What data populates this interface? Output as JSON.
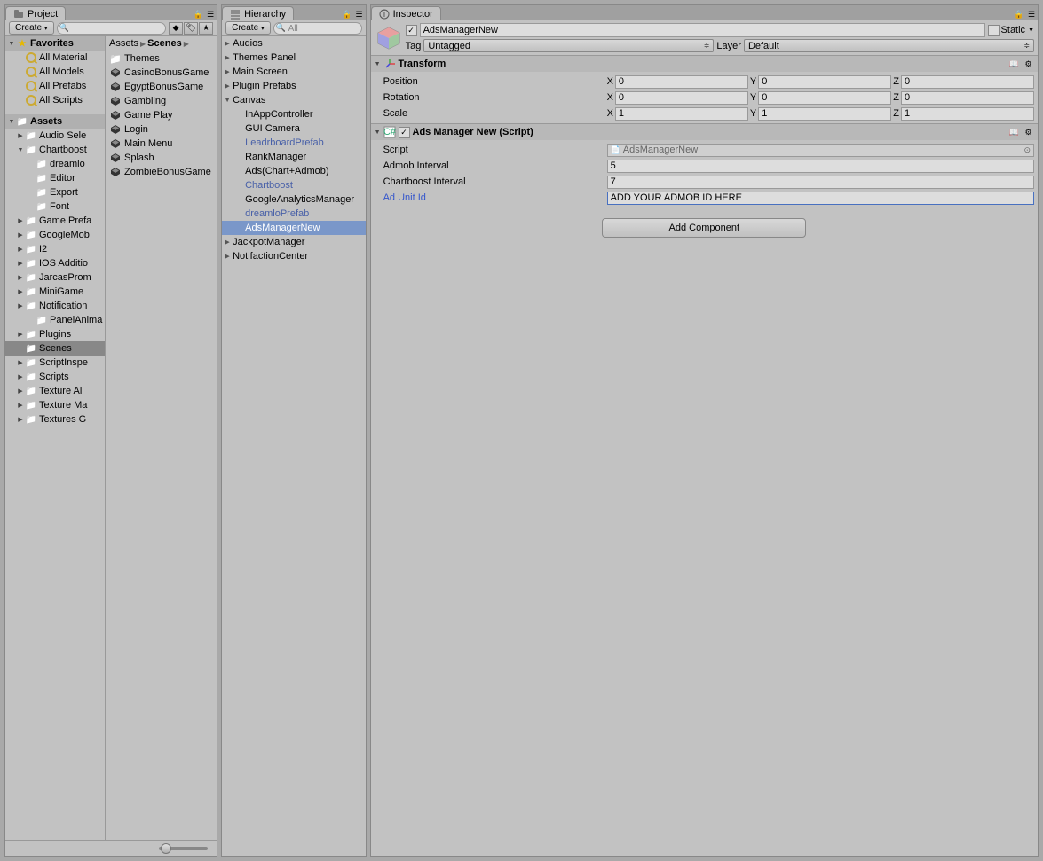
{
  "project": {
    "tab_label": "Project",
    "create_label": "Create",
    "search_placeholder": "",
    "favorites_label": "Favorites",
    "favorites": [
      "All Material",
      "All Models",
      "All Prefabs",
      "All Scripts"
    ],
    "assets_label": "Assets",
    "asset_folders": [
      {
        "name": "Audio Sele",
        "arrow": "closed"
      },
      {
        "name": "Chartboost",
        "arrow": "open"
      },
      {
        "name": "dreamlo",
        "arrow": "none",
        "indent": 2
      },
      {
        "name": "Editor",
        "arrow": "none",
        "indent": 2
      },
      {
        "name": "Export",
        "arrow": "none",
        "indent": 2
      },
      {
        "name": "Font",
        "arrow": "none",
        "indent": 2
      },
      {
        "name": "Game Prefa",
        "arrow": "closed"
      },
      {
        "name": "GoogleMob",
        "arrow": "closed"
      },
      {
        "name": "I2",
        "arrow": "closed"
      },
      {
        "name": "IOS Additio",
        "arrow": "closed"
      },
      {
        "name": "JarcasProm",
        "arrow": "closed"
      },
      {
        "name": "MiniGame",
        "arrow": "closed"
      },
      {
        "name": "Notification",
        "arrow": "closed"
      },
      {
        "name": "PanelAnima",
        "arrow": "none",
        "indent": 2
      },
      {
        "name": "Plugins",
        "arrow": "closed"
      },
      {
        "name": "Scenes",
        "arrow": "none",
        "selected": true
      },
      {
        "name": "ScriptInspe",
        "arrow": "closed"
      },
      {
        "name": "Scripts",
        "arrow": "closed"
      },
      {
        "name": "Texture All",
        "arrow": "closed"
      },
      {
        "name": "Texture Ma",
        "arrow": "closed"
      },
      {
        "name": "Textures G",
        "arrow": "closed"
      }
    ],
    "breadcrumb": [
      "Assets",
      "Scenes"
    ],
    "content": [
      {
        "name": "Themes",
        "type": "folder"
      },
      {
        "name": "CasinoBonusGame",
        "type": "unity"
      },
      {
        "name": "EgyptBonusGame",
        "type": "unity"
      },
      {
        "name": "Gambling",
        "type": "unity"
      },
      {
        "name": "Game Play",
        "type": "unity"
      },
      {
        "name": "Login",
        "type": "unity"
      },
      {
        "name": "Main Menu",
        "type": "unity"
      },
      {
        "name": "Splash",
        "type": "unity"
      },
      {
        "name": "ZombieBonusGame",
        "type": "unity"
      }
    ]
  },
  "hierarchy": {
    "tab_label": "Hierarchy",
    "create_label": "Create",
    "search_placeholder": "All",
    "items": [
      {
        "name": "Audios",
        "arrow": "closed",
        "indent": 0
      },
      {
        "name": "Themes Panel",
        "arrow": "closed",
        "indent": 0
      },
      {
        "name": "Main Screen",
        "arrow": "closed",
        "indent": 0
      },
      {
        "name": "Plugin Prefabs",
        "arrow": "closed",
        "indent": 0
      },
      {
        "name": "Canvas",
        "arrow": "open",
        "indent": 0
      },
      {
        "name": "InAppController",
        "arrow": "none",
        "indent": 1
      },
      {
        "name": "GUI Camera",
        "arrow": "none",
        "indent": 1
      },
      {
        "name": "LeadrboardPrefab",
        "arrow": "none",
        "indent": 1,
        "prefab": true
      },
      {
        "name": "RankManager",
        "arrow": "none",
        "indent": 1
      },
      {
        "name": "Ads(Chart+Admob)",
        "arrow": "none",
        "indent": 1
      },
      {
        "name": "Chartboost",
        "arrow": "none",
        "indent": 1,
        "prefab": true
      },
      {
        "name": "GoogleAnalyticsManager",
        "arrow": "none",
        "indent": 1
      },
      {
        "name": "dreamloPrefab",
        "arrow": "none",
        "indent": 1,
        "prefab": true
      },
      {
        "name": "AdsManagerNew",
        "arrow": "none",
        "indent": 1,
        "selected": true
      },
      {
        "name": "JackpotManager",
        "arrow": "closed",
        "indent": 0
      },
      {
        "name": "NotifactionCenter",
        "arrow": "closed",
        "indent": 0
      }
    ]
  },
  "inspector": {
    "tab_label": "Inspector",
    "object_name": "AdsManagerNew",
    "active": true,
    "static_label": "Static",
    "static_checked": false,
    "tag_label": "Tag",
    "tag_value": "Untagged",
    "layer_label": "Layer",
    "layer_value": "Default",
    "transform": {
      "title": "Transform",
      "position_label": "Position",
      "rotation_label": "Rotation",
      "scale_label": "Scale",
      "position": {
        "x": "0",
        "y": "0",
        "z": "0"
      },
      "rotation": {
        "x": "0",
        "y": "0",
        "z": "0"
      },
      "scale": {
        "x": "1",
        "y": "1",
        "z": "1"
      }
    },
    "script_component": {
      "title": "Ads Manager New (Script)",
      "enabled": true,
      "script_label": "Script",
      "script_value": "AdsManagerNew",
      "props": [
        {
          "label": "Admob Interval",
          "value": "5"
        },
        {
          "label": "Chartboost Interval",
          "value": "7"
        },
        {
          "label": "Ad Unit Id",
          "value": "ADD YOUR ADMOB ID HERE",
          "highlighted": true,
          "label_blue": true
        }
      ]
    },
    "add_component_label": "Add Component"
  }
}
